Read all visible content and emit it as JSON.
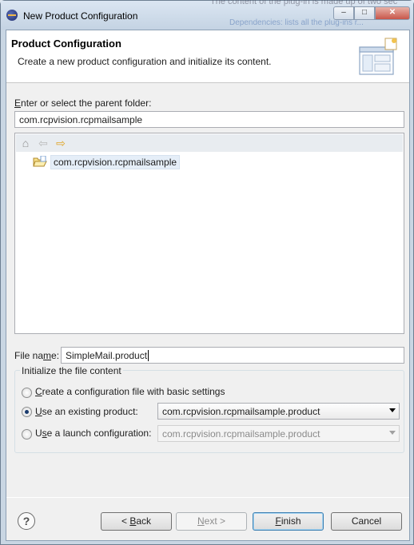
{
  "window": {
    "title": "New Product Configuration",
    "background_text": "The content of the plug-in is made up of two sec",
    "background_text2": "Dependencies: lists all the plug-ins r..."
  },
  "header": {
    "title": "Product Configuration",
    "description": "Create a new product configuration and initialize its content."
  },
  "parent_folder": {
    "label": "Enter or select the parent folder:",
    "value": "com.rcpvision.rcpmailsample"
  },
  "tree": {
    "items": [
      {
        "label": "com.rcpvision.rcpmailsample",
        "icon": "open-folder-icon"
      }
    ]
  },
  "file_name": {
    "label": "File name:",
    "value": "SimpleMail.product"
  },
  "init_group": {
    "title": "Initialize the file content",
    "options": [
      {
        "label": "Create a configuration file with basic settings",
        "checked": false
      },
      {
        "label": "Use an existing product:",
        "checked": true,
        "combo": "com.rcpvision.rcpmailsample.product"
      },
      {
        "label": "Use a launch configuration:",
        "checked": false,
        "combo": "com.rcpvision.rcpmailsample.product"
      }
    ]
  },
  "buttons": {
    "help": "?",
    "back": "< Back",
    "next": "Next >",
    "finish": "Finish",
    "cancel": "Cancel"
  },
  "colors": {
    "selection": "#e5eef8",
    "default_button_border": "#3c7fb1"
  }
}
